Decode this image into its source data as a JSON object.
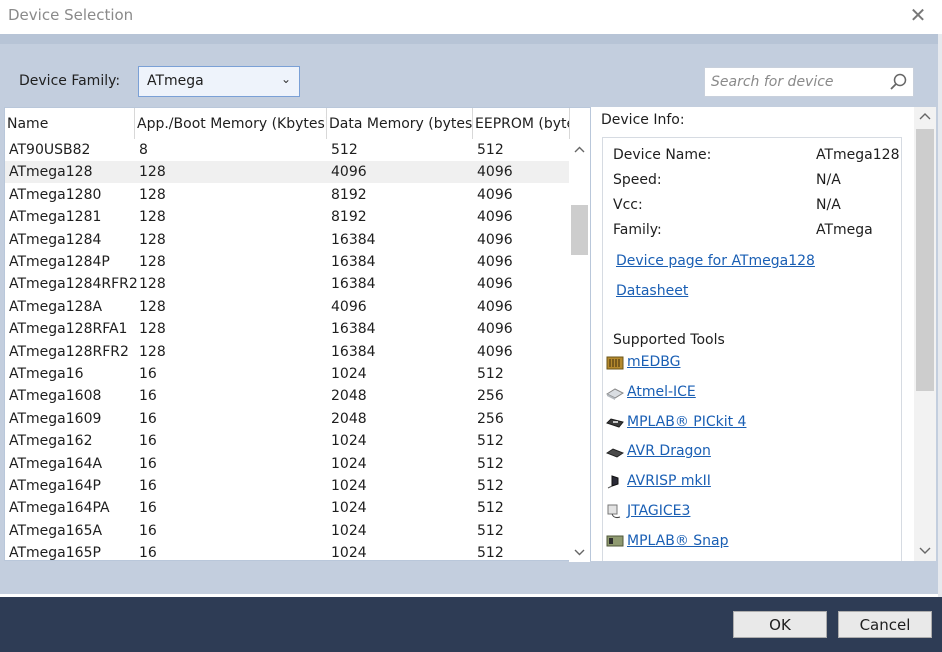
{
  "window": {
    "title": "Device Selection"
  },
  "family": {
    "label": "Device Family:",
    "selected": "ATmega"
  },
  "search": {
    "placeholder": "Search for device"
  },
  "table": {
    "columns": [
      "Name",
      "App./Boot Memory (Kbytes)",
      "Data Memory (bytes)",
      "EEPROM (byte"
    ],
    "rows": [
      [
        "AT90USB82",
        "8",
        "512",
        "512"
      ],
      [
        "ATmega128",
        "128",
        "4096",
        "4096"
      ],
      [
        "ATmega1280",
        "128",
        "8192",
        "4096"
      ],
      [
        "ATmega1281",
        "128",
        "8192",
        "4096"
      ],
      [
        "ATmega1284",
        "128",
        "16384",
        "4096"
      ],
      [
        "ATmega1284P",
        "128",
        "16384",
        "4096"
      ],
      [
        "ATmega1284RFR2",
        "128",
        "16384",
        "4096"
      ],
      [
        "ATmega128A",
        "128",
        "4096",
        "4096"
      ],
      [
        "ATmega128RFA1",
        "128",
        "16384",
        "4096"
      ],
      [
        "ATmega128RFR2",
        "128",
        "16384",
        "4096"
      ],
      [
        "ATmega16",
        "16",
        "1024",
        "512"
      ],
      [
        "ATmega1608",
        "16",
        "2048",
        "256"
      ],
      [
        "ATmega1609",
        "16",
        "2048",
        "256"
      ],
      [
        "ATmega162",
        "16",
        "1024",
        "512"
      ],
      [
        "ATmega164A",
        "16",
        "1024",
        "512"
      ],
      [
        "ATmega164P",
        "16",
        "1024",
        "512"
      ],
      [
        "ATmega164PA",
        "16",
        "1024",
        "512"
      ],
      [
        "ATmega165A",
        "16",
        "1024",
        "512"
      ],
      [
        "ATmega165P",
        "16",
        "1024",
        "512"
      ]
    ],
    "selected_row": "ATmega128"
  },
  "device_info": {
    "title": "Device Info:",
    "name_label": "Device Name:",
    "name_value": "ATmega128",
    "speed_label": "Speed:",
    "speed_value": "N/A",
    "vcc_label": "Vcc:",
    "vcc_value": "N/A",
    "family_label": "Family:",
    "family_value": "ATmega",
    "device_page_link": "Device page for ATmega128",
    "datasheet_link": "Datasheet",
    "tools_title": "Supported Tools",
    "tools": [
      "mEDBG",
      "Atmel-ICE",
      "MPLAB® PICkit 4",
      "AVR Dragon",
      "AVRISP mkII",
      "JTAGICE3",
      "MPLAB® Snap"
    ]
  },
  "footer": {
    "ok": "OK",
    "cancel": "Cancel"
  },
  "colors": {
    "panel_bg": "#c3cede",
    "footer_bg": "#2e3c55",
    "link": "#1a5fb4",
    "select_border": "#7aa0d6"
  }
}
